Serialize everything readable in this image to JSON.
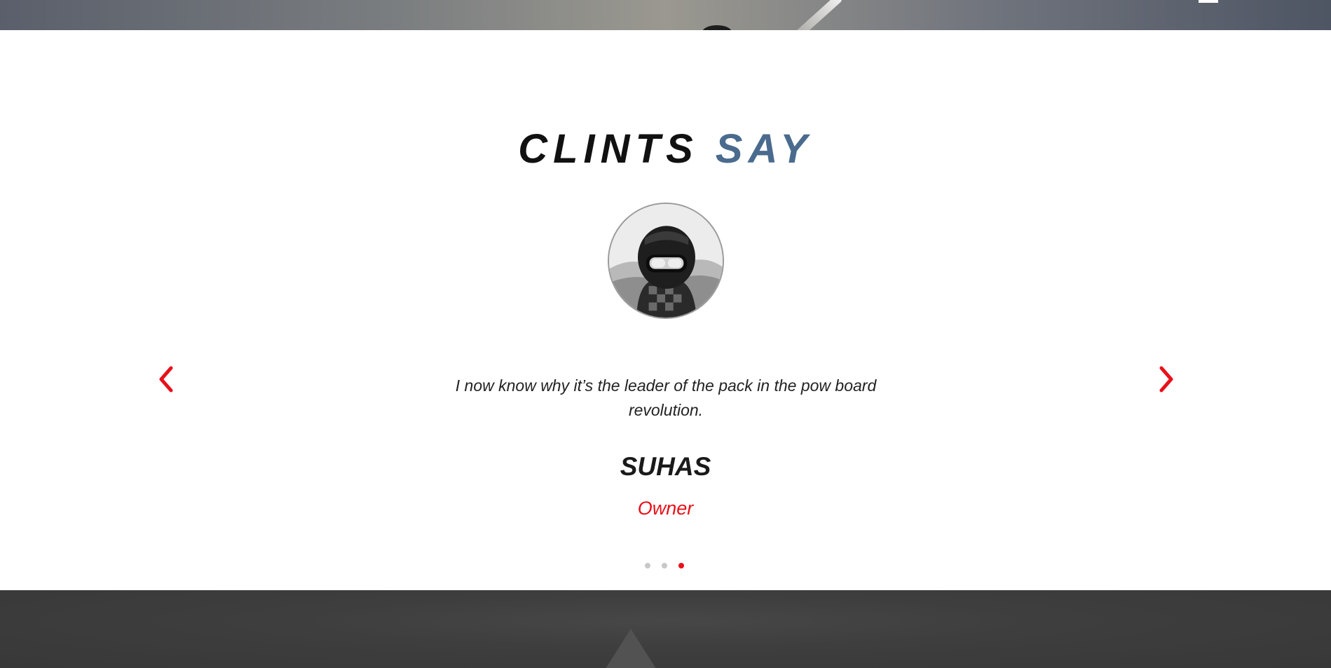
{
  "header": {
    "menu_icon": "hamburger-menu-icon"
  },
  "testimonials": {
    "title_main": "CLINTS",
    "title_accent": "SAY",
    "accent_color": "#4a6b8e",
    "highlight_color": "#e8101a",
    "current": {
      "quote": "I now know why it’s the leader of the pack in the pow board revolution.",
      "name": "SUHAS",
      "role": "Owner",
      "avatar_icon": "person-with-goggles-avatar"
    },
    "prev_icon": "chevron-left-icon",
    "next_icon": "chevron-right-icon",
    "slides_total": 3,
    "active_slide": 3
  }
}
